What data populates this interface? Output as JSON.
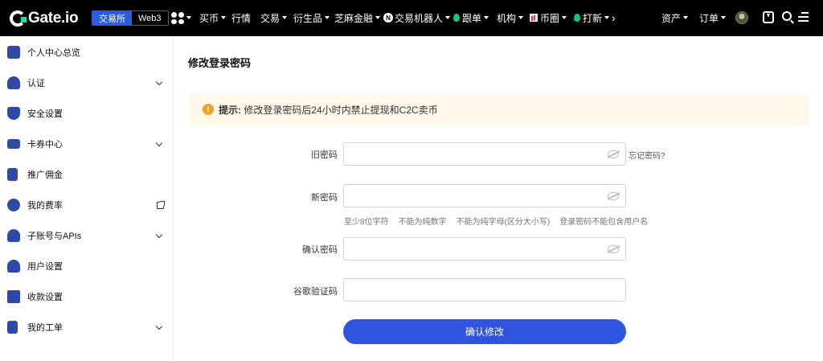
{
  "header": {
    "logo_text": "Gate.io",
    "segment": {
      "active": "交易所",
      "inactive": "Web3"
    },
    "nav": [
      {
        "label": "买币",
        "dropdown": true
      },
      {
        "label": "行情",
        "dropdown": false
      },
      {
        "label": "交易",
        "dropdown": true
      },
      {
        "label": "衍生品",
        "dropdown": true
      },
      {
        "label": "芝麻金融",
        "dropdown": true
      },
      {
        "label": "交易机器人",
        "dropdown": true,
        "icon": "n-badge-icon"
      },
      {
        "label": "跟单",
        "dropdown": true,
        "icon": "flame-icon"
      },
      {
        "label": "机构",
        "dropdown": true
      },
      {
        "label": "币圈",
        "dropdown": true,
        "icon": "chart-icon"
      },
      {
        "label": "打新",
        "dropdown": true,
        "icon": "flame-icon"
      }
    ],
    "more_glyph": "›",
    "right": {
      "assets": "资产",
      "orders": "订单"
    },
    "icons": [
      "apps-grid-icon",
      "avatar",
      "download-icon",
      "search-icon",
      "menu-icon"
    ]
  },
  "sidebar": {
    "items": [
      {
        "label": "个人中心总览",
        "icon": "profile-card-icon",
        "chevron": false,
        "external": false
      },
      {
        "label": "认证",
        "icon": "user-verify-icon",
        "chevron": true,
        "external": false
      },
      {
        "label": "安全设置",
        "icon": "shield-icon",
        "chevron": false,
        "external": false
      },
      {
        "label": "卡券中心",
        "icon": "ticket-icon",
        "chevron": true,
        "external": false
      },
      {
        "label": "推广佣金",
        "icon": "referral-icon",
        "chevron": false,
        "external": false
      },
      {
        "label": "我的费率",
        "icon": "fee-icon",
        "chevron": false,
        "external": true
      },
      {
        "label": "子账号与APIs",
        "icon": "subaccount-icon",
        "chevron": true,
        "external": false
      },
      {
        "label": "用户设置",
        "icon": "user-settings-icon",
        "chevron": false,
        "external": false
      },
      {
        "label": "收款设置",
        "icon": "payment-icon",
        "chevron": false,
        "external": false
      },
      {
        "label": "我的工单",
        "icon": "ticket-list-icon",
        "chevron": true,
        "external": false
      }
    ]
  },
  "main": {
    "title": "修改登录密码",
    "alert": {
      "icon": "!",
      "prefix": "提示:",
      "text": " 修改登录密码后24小时内禁止提现和C2C卖币"
    },
    "form": {
      "old_password_label": "旧密码",
      "forgot_link": "忘记密码?",
      "new_password_label": "新密码",
      "hints": [
        "至少8位字符",
        "不能为纯数字",
        "不能为纯字母(区分大小写)",
        "登录密码不能包含用户名"
      ],
      "confirm_password_label": "确认密码",
      "google_code_label": "谷歌验证码",
      "submit_label": "确认修改"
    }
  },
  "colors": {
    "accent": "#2f55e0",
    "topbar": "#000000",
    "alert_bg": "#fff8e8",
    "alert_icon": "#f19e2b",
    "brand_green": "#17e6a1"
  }
}
